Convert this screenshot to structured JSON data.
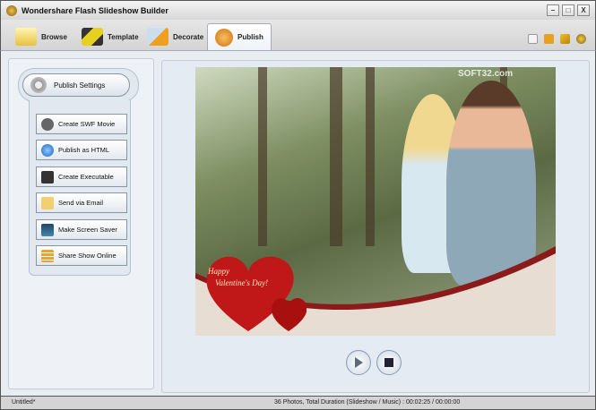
{
  "window": {
    "title": "Wondershare Flash Slideshow Builder",
    "minimize": "–",
    "maximize": "□",
    "close": "X"
  },
  "tabs": [
    {
      "label": "Browse"
    },
    {
      "label": "Template"
    },
    {
      "label": "Decorate"
    },
    {
      "label": "Publish",
      "active": true
    }
  ],
  "toolbar": {
    "icons": [
      "new-icon",
      "save-icon",
      "settings-icon",
      "help-icon"
    ]
  },
  "publish": {
    "settings_label": "Publish Settings",
    "options": [
      {
        "label": "Create SWF Movie",
        "icon": "swf-icon"
      },
      {
        "label": "Publish as HTML",
        "icon": "ie-icon"
      },
      {
        "label": "Create Executable",
        "icon": "exe-icon"
      },
      {
        "label": "Send via Email",
        "icon": "email-icon"
      },
      {
        "label": "Make Screen Saver",
        "icon": "monitor-icon"
      },
      {
        "label": "Share Show Online",
        "icon": "share-icon"
      }
    ]
  },
  "preview": {
    "greeting_line1": "Happy",
    "greeting_line2": "Valentine's Day!",
    "watermark": "SOFT32.com"
  },
  "status": {
    "file": "Untitled*",
    "summary": "36 Photos, Total Duration (Slideshow / Music) : 00:02:25 / 00:00:00"
  }
}
